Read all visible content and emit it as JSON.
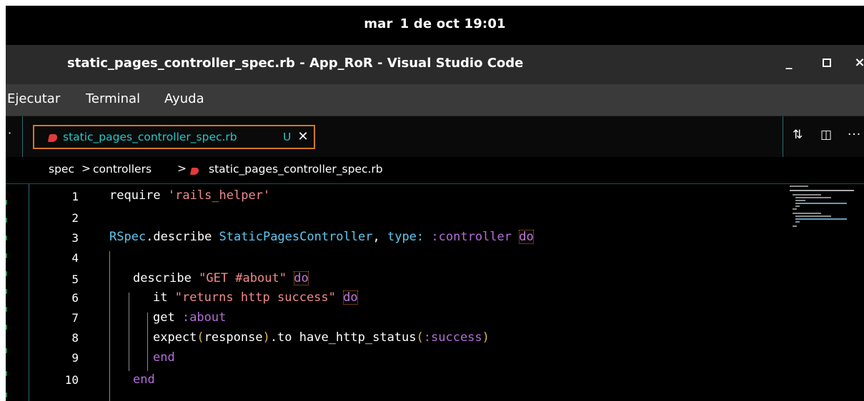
{
  "system": {
    "day": "mar",
    "date_time": "1 de oct 19:01"
  },
  "window": {
    "title": "static_pages_controller_spec.rb - App_RoR - Visual Studio Code",
    "minimize_glyph": "_",
    "close_glyph": "×"
  },
  "menu": {
    "items": [
      "Ejecutar",
      "Terminal",
      "Ayuda"
    ]
  },
  "tabs": {
    "left_glyph": "·",
    "active": {
      "label": "static_pages_controller_spec.rb",
      "status": "U",
      "close_glyph": "✕",
      "icon": "ruby-file-icon"
    },
    "actions": [
      {
        "icon": "source-control-compare-icon",
        "glyph": "⇅"
      },
      {
        "icon": "split-editor-icon",
        "glyph": "◫"
      },
      {
        "icon": "more-actions-icon",
        "glyph": "···"
      }
    ]
  },
  "breadcrumb": {
    "segments": [
      "spec",
      "controllers",
      "static_pages_controller_spec.rb"
    ],
    "separator": ">"
  },
  "editor": {
    "line_numbers": [
      "1",
      "2",
      "3",
      "4",
      "5",
      "6",
      "7",
      "8",
      "9",
      "10"
    ],
    "code": {
      "l1": {
        "kw": "require ",
        "str": "'rails_helper'"
      },
      "l3": {
        "const1": "RSpec",
        "plain1": ".describe ",
        "const2": "StaticPagesController",
        "plain2": ", ",
        "key": "type:",
        "plain3": " ",
        "sym": ":controller",
        "plain4": " ",
        "do": "do"
      },
      "l5": {
        "kw": "describe ",
        "str": "\"GET #about\"",
        "plain": " ",
        "do": "do"
      },
      "l6": {
        "kw": "it ",
        "str": "\"returns http success\"",
        "plain": " ",
        "do": "do"
      },
      "l7": {
        "kw": "get ",
        "sym": ":about"
      },
      "l8": {
        "kw1": "expect",
        "p1": "(",
        "arg": "response",
        "p2": ")",
        "kw2": ".to have_http_status",
        "p3": "(",
        "sym": ":success",
        "p4": ")"
      },
      "l9": {
        "end": "end"
      },
      "l10": {
        "end": "end"
      }
    }
  },
  "colors": {
    "tab_border": "#d47820",
    "ruby_icon": "#e23a3a",
    "tab_text": "#24c8c8",
    "string": "#f08a8a",
    "constant": "#5ec7f0",
    "symbol": "#b36dd8"
  }
}
